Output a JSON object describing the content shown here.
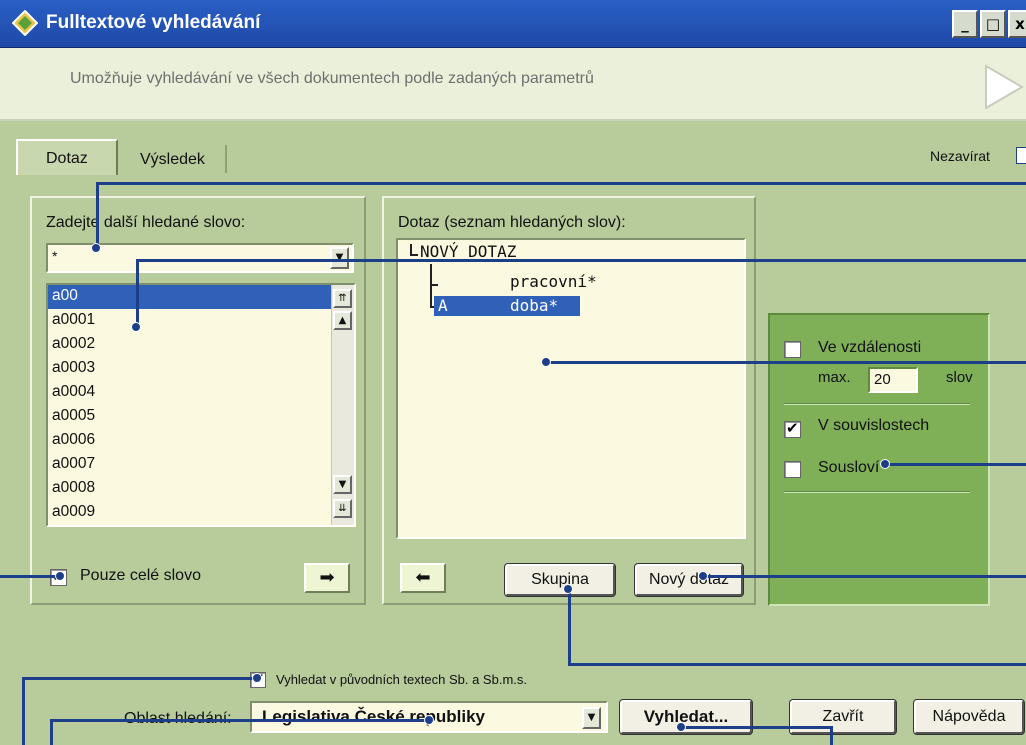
{
  "window": {
    "title": "Fulltextové vyhledávání",
    "controls": [
      "_",
      "□",
      "x"
    ]
  },
  "banner": {
    "description": "Umožňuje vyhledávání ve všech dokumentech podle zadaných parametrů"
  },
  "tabs": [
    {
      "label": "Dotaz",
      "active": true
    },
    {
      "label": "Výsledek",
      "active": false
    }
  ],
  "nezavirat": {
    "label": "Nezavírat"
  },
  "word_panel": {
    "label": "Zadejte další hledané slovo:",
    "input_value": "*",
    "words": [
      "a00",
      "a0001",
      "a0002",
      "a0003",
      "a0004",
      "a0005",
      "a0006",
      "a0007",
      "a0008",
      "a0009"
    ],
    "selected_index": 0,
    "whole_word_label": "Pouze celé slovo",
    "whole_word_checked": true,
    "add_arrow": "➡"
  },
  "query_panel": {
    "label": "Dotaz (seznam hledaných slov):",
    "tree": {
      "root": "NOVÝ DOTAZ",
      "items": [
        {
          "operator": "",
          "word": "pracovní*"
        },
        {
          "operator": "A",
          "word": "doba*",
          "selected": true
        }
      ]
    },
    "remove_arrow": "⬅",
    "group_button": "Skupina",
    "new_query_button": "Nový dotaz"
  },
  "options": {
    "distance_label": "Ve vzdálenosti",
    "distance_checked": false,
    "max_label": "max.",
    "max_value": "20",
    "words_unit": "slov",
    "context_label": "V souvislostech",
    "context_checked": true,
    "phrase_label": "Sousloví",
    "phrase_checked": false
  },
  "bottom": {
    "search_original_label": "Vyhledat v původních textech Sb. a Sb.m.s.",
    "search_original_checked": true,
    "area_label": "Oblast hledání:",
    "area_value": "Legislativa České republiky",
    "search_button": "Vyhledat...",
    "close_button": "Zavřít",
    "help_button": "Nápověda"
  },
  "colors": {
    "titlebar": "#1e49a8",
    "background": "#b7cc9a",
    "selection": "#2f61b8",
    "callout": "#1d3f8a",
    "options_panel": "#7fb058"
  }
}
